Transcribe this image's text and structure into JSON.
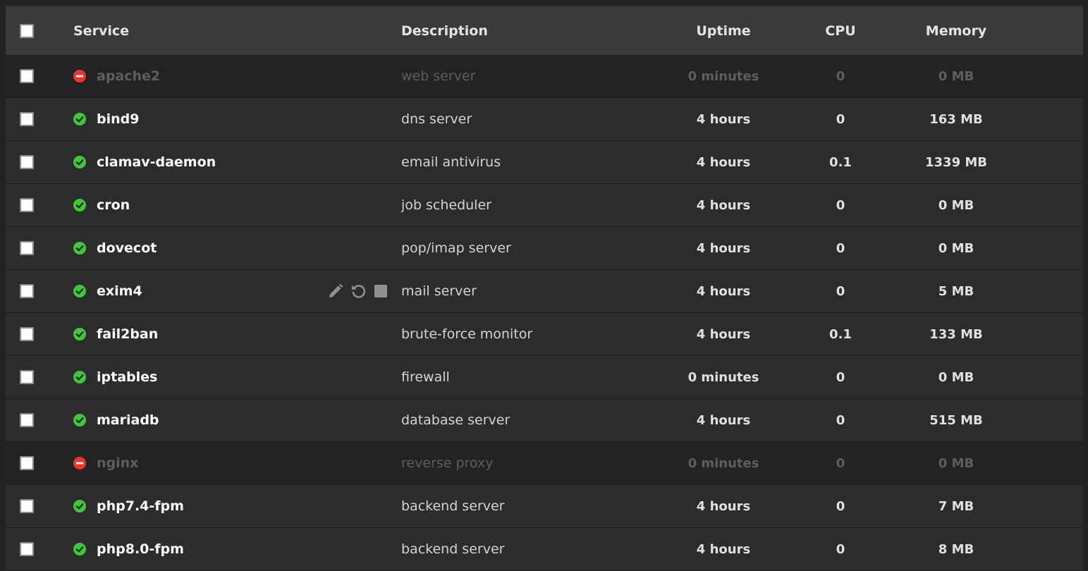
{
  "colors": {
    "running": "#3fc63f",
    "stopped": "#e83535",
    "header_bg": "#3a3a3a",
    "row_bg": "#2c2c2c",
    "disabled_row_bg": "#232323"
  },
  "header": {
    "service": "Service",
    "description": "Description",
    "uptime": "Uptime",
    "cpu": "CPU",
    "memory": "Memory"
  },
  "rows": [
    {
      "name": "apache2",
      "description": "web server",
      "uptime": "0 minutes",
      "cpu": "0",
      "memory": "0 MB",
      "status": "stopped",
      "status_icon": "stopped-icon"
    },
    {
      "name": "bind9",
      "description": "dns server",
      "uptime": "4 hours",
      "cpu": "0",
      "memory": "163 MB",
      "status": "running",
      "status_icon": "running-check-icon"
    },
    {
      "name": "clamav-daemon",
      "description": "email antivirus",
      "uptime": "4 hours",
      "cpu": "0.1",
      "memory": "1339 MB",
      "status": "running",
      "status_icon": "running-check-icon"
    },
    {
      "name": "cron",
      "description": "job scheduler",
      "uptime": "4 hours",
      "cpu": "0",
      "memory": "0 MB",
      "status": "running",
      "status_icon": "running-check-icon"
    },
    {
      "name": "dovecot",
      "description": "pop/imap server",
      "uptime": "4 hours",
      "cpu": "0",
      "memory": "0 MB",
      "status": "running",
      "status_icon": "running-check-icon"
    },
    {
      "name": "exim4",
      "description": "mail server",
      "uptime": "4 hours",
      "cpu": "0",
      "memory": "5 MB",
      "status": "running",
      "status_icon": "running-check-icon",
      "hover_actions": [
        "edit-pencil-icon",
        "restart-icon",
        "stop-icon"
      ]
    },
    {
      "name": "fail2ban",
      "description": "brute-force monitor",
      "uptime": "4 hours",
      "cpu": "0.1",
      "memory": "133 MB",
      "status": "running",
      "status_icon": "running-check-icon"
    },
    {
      "name": "iptables",
      "description": "firewall",
      "uptime": "0 minutes",
      "cpu": "0",
      "memory": "0 MB",
      "status": "running",
      "status_icon": "running-check-icon"
    },
    {
      "name": "mariadb",
      "description": "database server",
      "uptime": "4 hours",
      "cpu": "0",
      "memory": "515 MB",
      "status": "running",
      "status_icon": "running-check-icon"
    },
    {
      "name": "nginx",
      "description": "reverse proxy",
      "uptime": "0 minutes",
      "cpu": "0",
      "memory": "0 MB",
      "status": "stopped",
      "status_icon": "stopped-icon"
    },
    {
      "name": "php7.4-fpm",
      "description": "backend server",
      "uptime": "4 hours",
      "cpu": "0",
      "memory": "7 MB",
      "status": "running",
      "status_icon": "running-check-icon"
    },
    {
      "name": "php8.0-fpm",
      "description": "backend server",
      "uptime": "4 hours",
      "cpu": "0",
      "memory": "8 MB",
      "status": "running",
      "status_icon": "running-check-icon"
    }
  ]
}
